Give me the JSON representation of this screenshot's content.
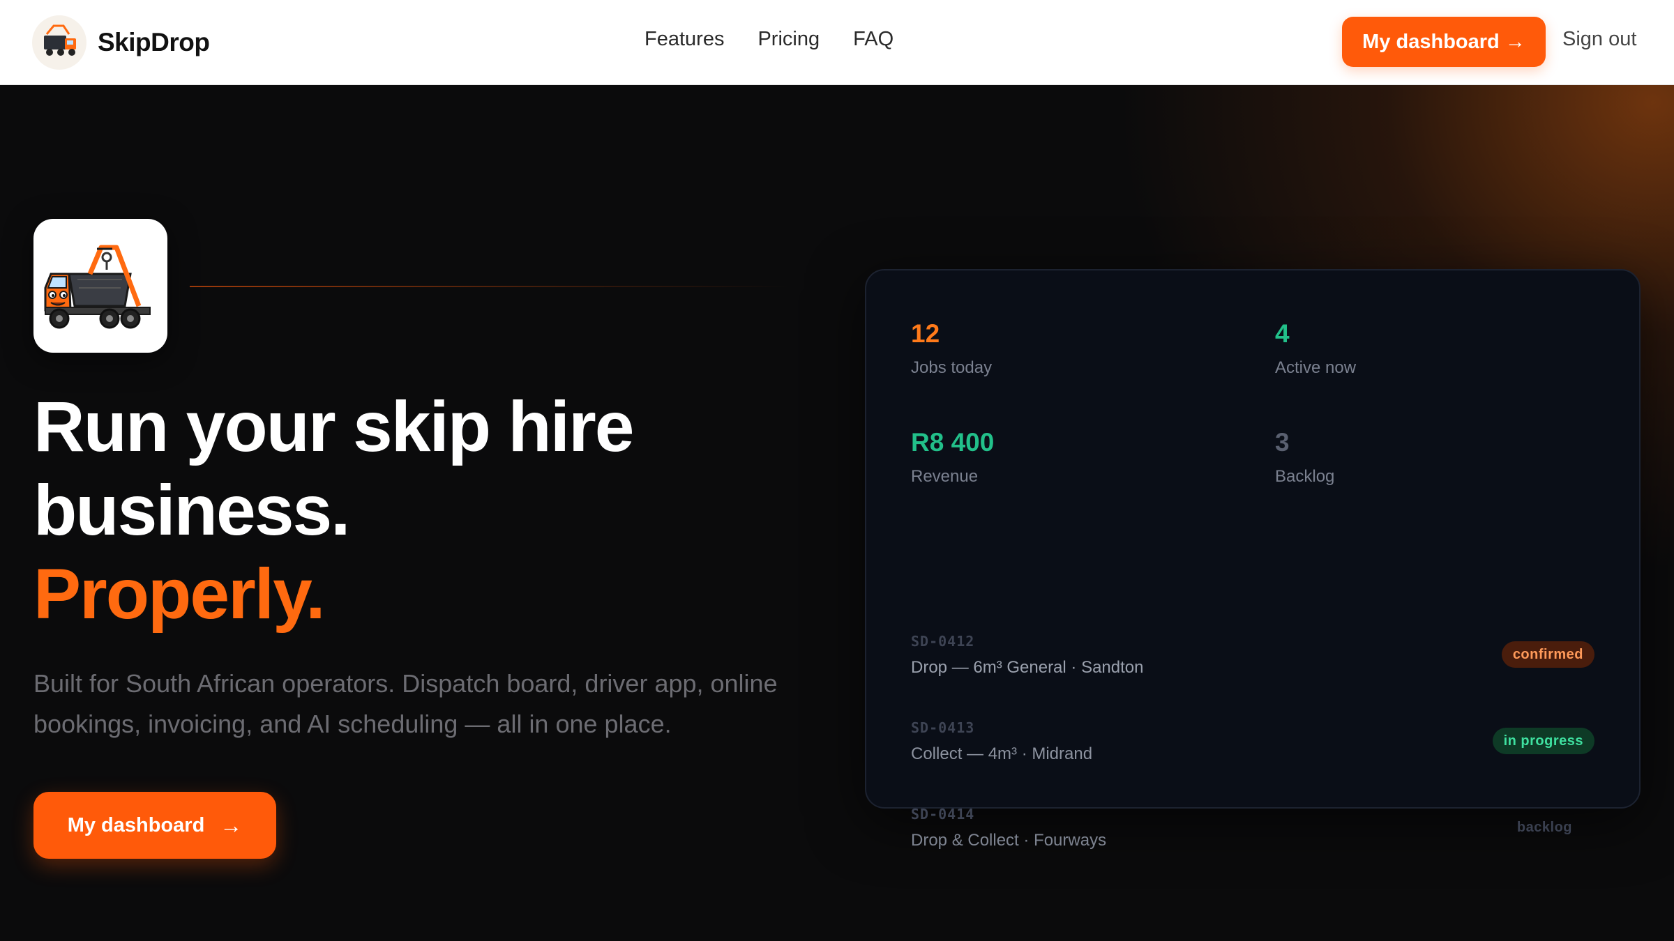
{
  "nav": {
    "brand": "SkipDrop",
    "links": [
      "Features",
      "Pricing",
      "FAQ"
    ],
    "cta_label": "My dashboard →",
    "signout_label": "Sign out"
  },
  "hero": {
    "headline_line1": "Run your skip hire",
    "headline_line2": "business.",
    "headline_accent": "Properly.",
    "subcopy": "Built for South African operators. Dispatch board, driver app, online bookings, invoicing, and AI scheduling — all in one place.",
    "cta_label": "My dashboard",
    "cta_icon": "arrow-right-icon"
  },
  "dashboard": {
    "stats": [
      {
        "value": "12",
        "label": "Jobs today",
        "color": "#ff7a1a"
      },
      {
        "value": "4",
        "label": "Active now",
        "color": "#22c08a"
      },
      {
        "value": "R8 400",
        "label": "Revenue",
        "color": "#22c08a"
      },
      {
        "value": "3",
        "label": "Backlog",
        "color": "#5a6070"
      }
    ],
    "jobs": [
      {
        "id": "SD-0412",
        "desc": "Drop — 6m³ General · Sandton",
        "status": "confirmed"
      },
      {
        "id": "SD-0413",
        "desc": "Collect — 4m³ · Midrand",
        "status": "in progress"
      },
      {
        "id": "SD-0414",
        "desc": "Drop & Collect · Fourways",
        "status": "backlog"
      }
    ]
  },
  "colors": {
    "accent": "#ff5a0a",
    "accent_text": "#ff6a10",
    "success": "#22c08a",
    "background": "#0b0b0c",
    "card": "#0a0e17"
  }
}
